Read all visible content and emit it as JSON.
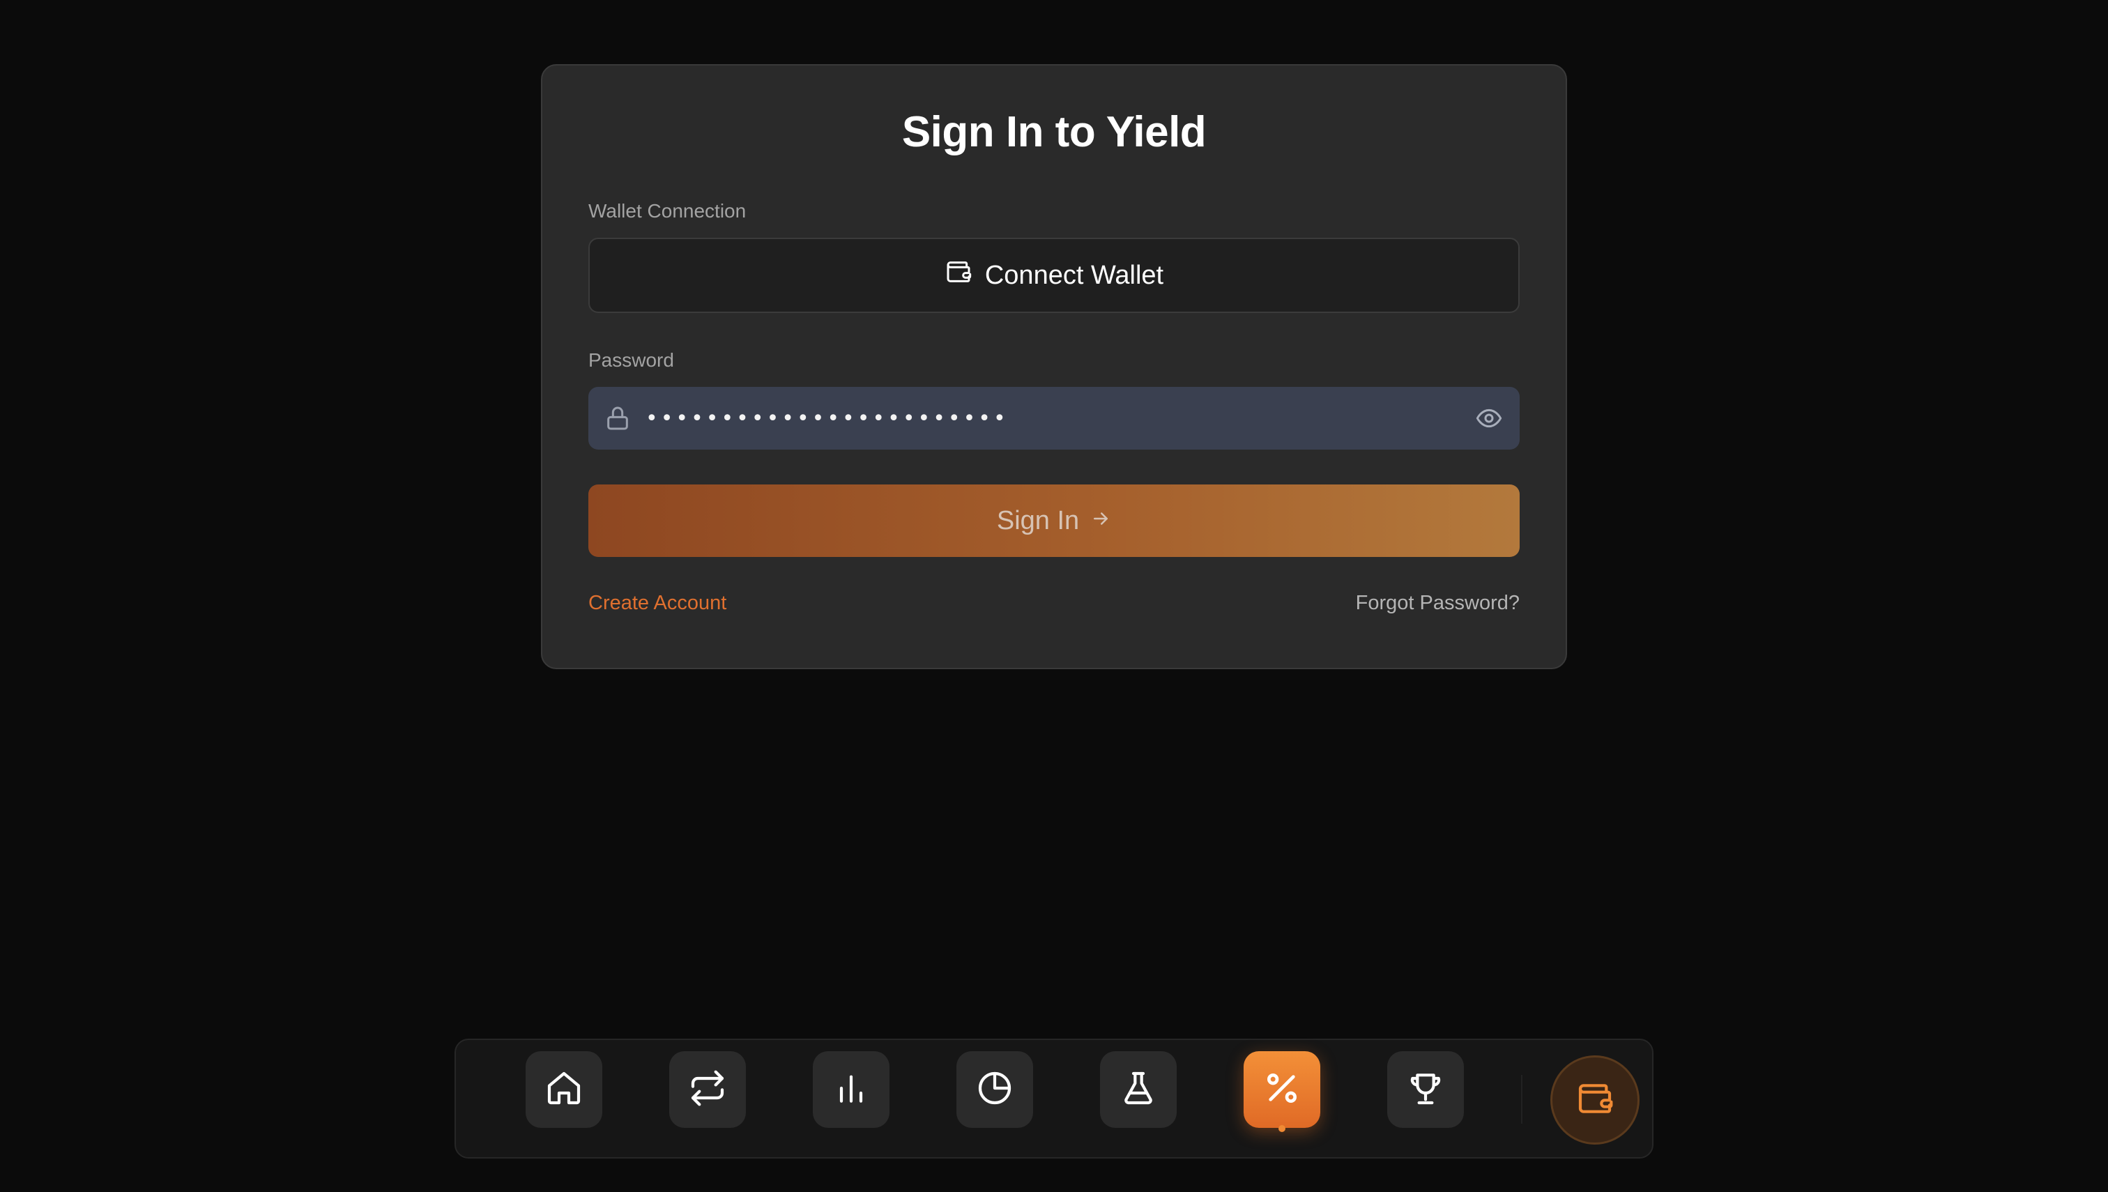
{
  "card": {
    "title": "Sign In to Yield",
    "wallet_label": "Wallet Connection",
    "wallet_button": "Connect Wallet",
    "password_label": "Password",
    "password_value": "xxxxxxxxxxxxxxxxxxxxxxxx",
    "signin_button": "Sign In",
    "create_account": "Create Account",
    "forgot_password": "Forgot Password?"
  },
  "dock": {
    "items": [
      {
        "icon": "home-icon"
      },
      {
        "icon": "swap-icon"
      },
      {
        "icon": "bar-chart-icon"
      },
      {
        "icon": "pie-chart-icon"
      },
      {
        "icon": "flask-icon"
      },
      {
        "icon": "percent-icon",
        "active": true
      },
      {
        "icon": "trophy-icon"
      }
    ],
    "wallet_icon": "wallet-icon"
  },
  "colors": {
    "accent": "#e0702f",
    "card_bg": "#2a2a2a",
    "page_bg": "#0b0b0b",
    "input_bg": "#3a4050"
  }
}
